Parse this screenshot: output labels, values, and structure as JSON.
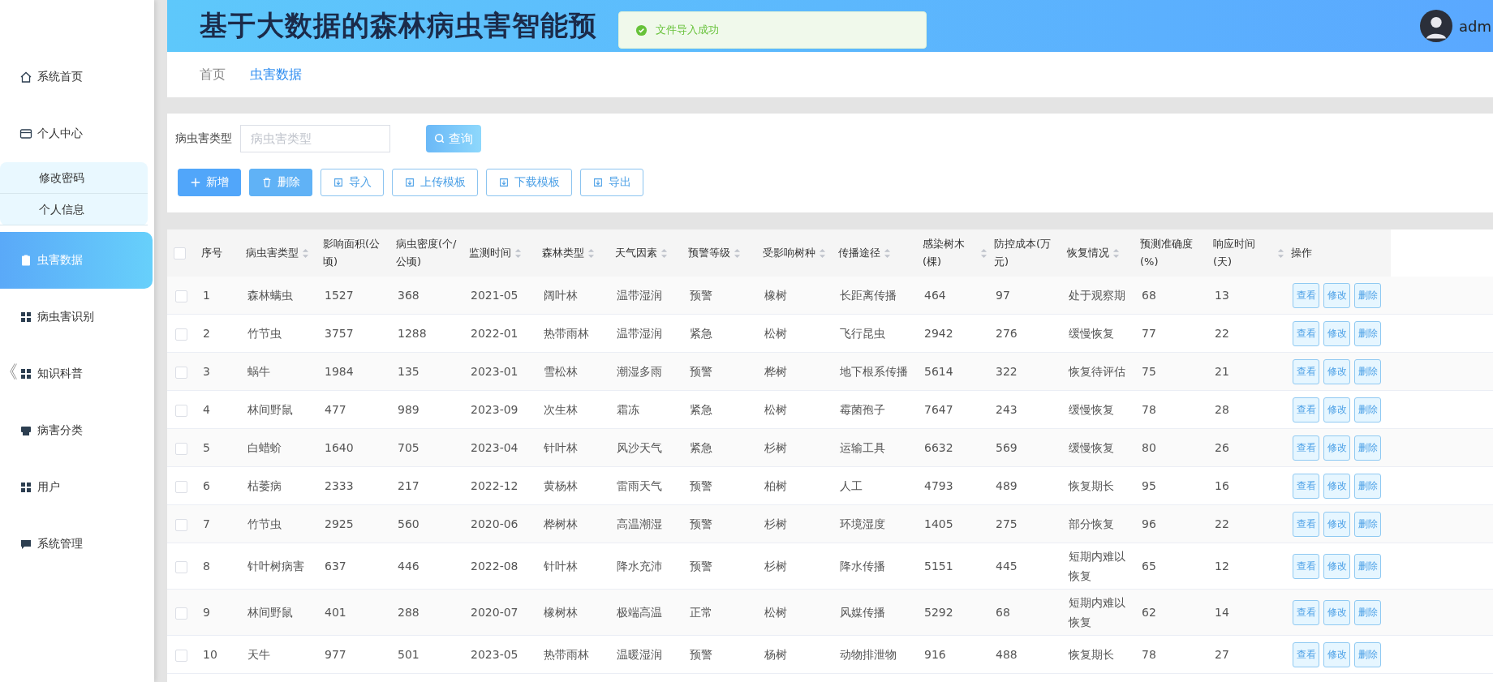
{
  "header": {
    "title": "基于大数据的森林病虫害智能预",
    "user": "adm"
  },
  "toast": {
    "message": "文件导入成功"
  },
  "sidebar": {
    "items": [
      {
        "label": "系统首页",
        "selected": false
      },
      {
        "label": "个人中心",
        "selected": false,
        "expanded": true,
        "children": [
          {
            "label": "修改密码"
          },
          {
            "label": "个人信息"
          }
        ]
      },
      {
        "label": "虫害数据",
        "selected": true
      },
      {
        "label": "病虫害识别",
        "selected": false
      },
      {
        "label": "知识科普",
        "selected": false
      },
      {
        "label": "病害分类",
        "selected": false
      },
      {
        "label": "用户",
        "selected": false
      },
      {
        "label": "系统管理",
        "selected": false
      }
    ],
    "collapse": "《"
  },
  "breadcrumb": [
    {
      "label": "首页",
      "selected": false
    },
    {
      "label": "虫害数据",
      "selected": true
    }
  ],
  "filter": {
    "label": "病虫害类型",
    "placeholder": "病虫害类型",
    "button": "查询"
  },
  "actions": [
    {
      "label": "新增",
      "kind": "primary"
    },
    {
      "label": "删除",
      "kind": "danger"
    },
    {
      "label": "导入",
      "kind": "plain"
    },
    {
      "label": "上传模板",
      "kind": "plain"
    },
    {
      "label": "下载模板",
      "kind": "plain"
    },
    {
      "label": "导出",
      "kind": "plain"
    }
  ],
  "table": {
    "select_all_checked": false,
    "columns": [
      {
        "label": "序号",
        "sortable": false
      },
      {
        "label": "病虫害类型",
        "sortable": true
      },
      {
        "label": "影响面积(公顷)",
        "sortable": false
      },
      {
        "label": "病虫密度(个/公顷)",
        "sortable": false
      },
      {
        "label": "监测时间",
        "sortable": true
      },
      {
        "label": "森林类型",
        "sortable": true
      },
      {
        "label": "天气因素",
        "sortable": true
      },
      {
        "label": "预警等级",
        "sortable": true
      },
      {
        "label": "受影响树种",
        "sortable": true
      },
      {
        "label": "传播途径",
        "sortable": true
      },
      {
        "label": "感染树木(棵)",
        "sortable": true
      },
      {
        "label": "防控成本(万元)",
        "sortable": false
      },
      {
        "label": "恢复情况",
        "sortable": true
      },
      {
        "label": "预测准确度(%)",
        "sortable": false
      },
      {
        "label": "响应时间(天)",
        "sortable": true
      },
      {
        "label": "操作",
        "sortable": false
      }
    ],
    "rows": [
      {
        "checked": false,
        "cells": [
          "1",
          "森林螨虫",
          "1527",
          "368",
          "2021-05",
          "阔叶林",
          "温带湿润",
          "预警",
          "橡树",
          "长距离传播",
          "464",
          "97",
          "处于观察期",
          "68",
          "13"
        ],
        "buttons": [
          "查看",
          "修改",
          "删除"
        ]
      },
      {
        "checked": false,
        "cells": [
          "2",
          "竹节虫",
          "3757",
          "1288",
          "2022-01",
          "热带雨林",
          "温带湿润",
          "紧急",
          "松树",
          "飞行昆虫",
          "2942",
          "276",
          "缓慢恢复",
          "77",
          "22"
        ],
        "buttons": [
          "查看",
          "修改",
          "删除"
        ]
      },
      {
        "checked": false,
        "cells": [
          "3",
          "蜗牛",
          "1984",
          "135",
          "2023-01",
          "雪松林",
          "潮湿多雨",
          "预警",
          "桦树",
          "地下根系传播",
          "5614",
          "322",
          "恢复待评估",
          "75",
          "21"
        ],
        "buttons": [
          "查看",
          "修改",
          "删除"
        ]
      },
      {
        "checked": false,
        "cells": [
          "4",
          "林间野鼠",
          "477",
          "989",
          "2023-09",
          "次生林",
          "霜冻",
          "紧急",
          "松树",
          "霉菌孢子",
          "7647",
          "243",
          "缓慢恢复",
          "78",
          "28"
        ],
        "buttons": [
          "查看",
          "修改",
          "删除"
        ]
      },
      {
        "checked": false,
        "cells": [
          "5",
          "白蜡蚧",
          "1640",
          "705",
          "2023-04",
          "针叶林",
          "风沙天气",
          "紧急",
          "杉树",
          "运输工具",
          "6632",
          "569",
          "缓慢恢复",
          "80",
          "26"
        ],
        "buttons": [
          "查看",
          "修改",
          "删除"
        ]
      },
      {
        "checked": false,
        "cells": [
          "6",
          "枯萎病",
          "2333",
          "217",
          "2022-12",
          "黄杨林",
          "雷雨天气",
          "预警",
          "柏树",
          "人工",
          "4793",
          "489",
          "恢复期长",
          "95",
          "16"
        ],
        "buttons": [
          "查看",
          "修改",
          "删除"
        ]
      },
      {
        "checked": false,
        "cells": [
          "7",
          "竹节虫",
          "2925",
          "560",
          "2020-06",
          "桦树林",
          "高温潮湿",
          "预警",
          "杉树",
          "环境湿度",
          "1405",
          "275",
          "部分恢复",
          "96",
          "22"
        ],
        "buttons": [
          "查看",
          "修改",
          "删除"
        ]
      },
      {
        "checked": false,
        "cells": [
          "8",
          "针叶树病害",
          "637",
          "446",
          "2022-08",
          "针叶林",
          "降水充沛",
          "预警",
          "杉树",
          "降水传播",
          "5151",
          "445",
          "短期内难以恢复",
          "65",
          "12"
        ],
        "buttons": [
          "查看",
          "修改",
          "删除"
        ]
      },
      {
        "checked": false,
        "cells": [
          "9",
          "林间野鼠",
          "401",
          "288",
          "2020-07",
          "橡树林",
          "极端高温",
          "正常",
          "松树",
          "风媒传播",
          "5292",
          "68",
          "短期内难以恢复",
          "62",
          "14"
        ],
        "buttons": [
          "查看",
          "修改",
          "删除"
        ]
      },
      {
        "checked": false,
        "cells": [
          "10",
          "天牛",
          "977",
          "501",
          "2023-05",
          "热带雨林",
          "温暖湿润",
          "预警",
          "杨树",
          "动物排泄物",
          "916",
          "488",
          "恢复期长",
          "78",
          "27"
        ],
        "buttons": [
          "查看",
          "修改",
          "删除"
        ]
      }
    ]
  }
}
